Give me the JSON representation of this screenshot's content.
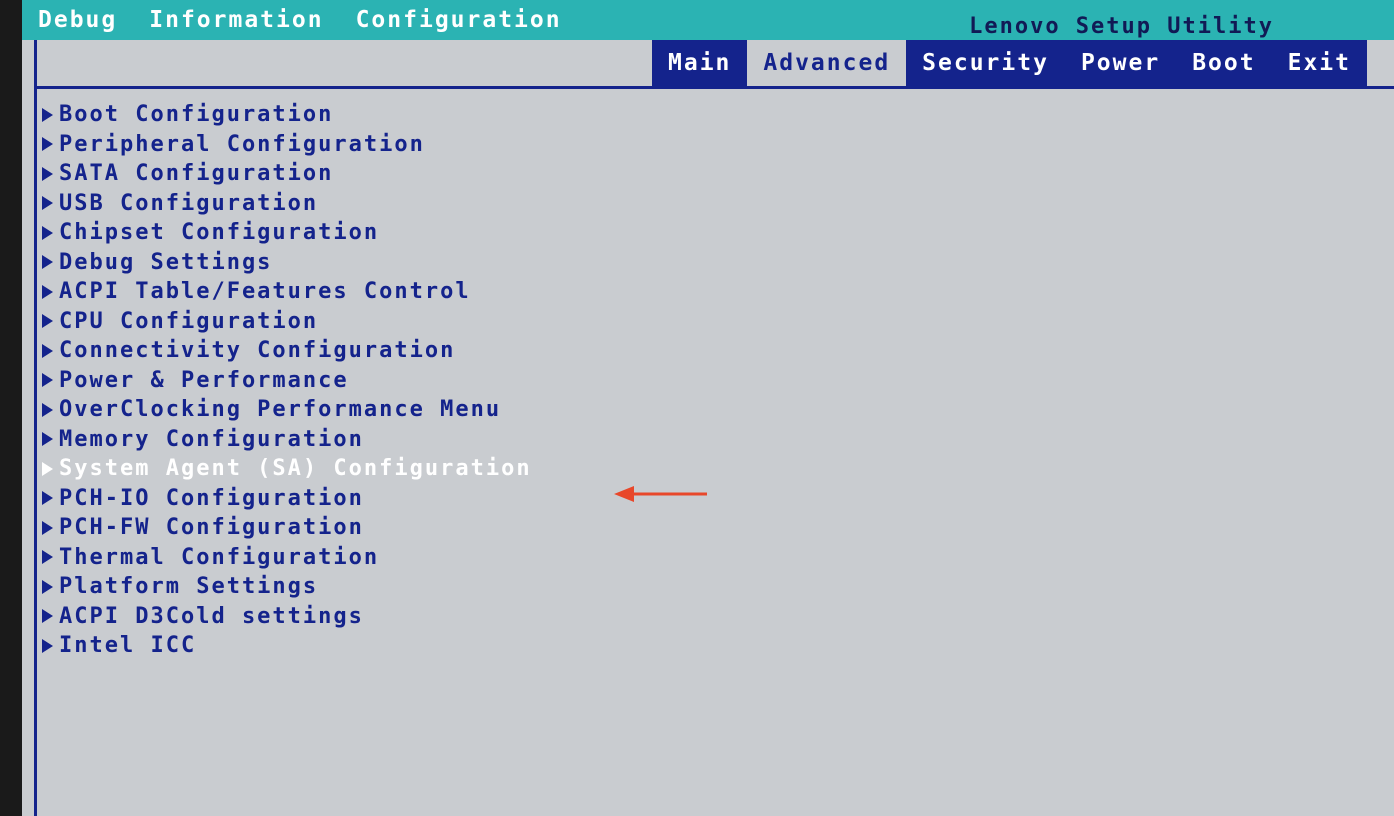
{
  "header": {
    "title": "Lenovo Setup Utility",
    "tabs_left": [
      "Debug",
      "Information",
      "Configuration"
    ],
    "tabs_right": [
      "Main",
      "Advanced",
      "Security",
      "Power",
      "Boot",
      "Exit"
    ],
    "active_tab": "Advanced"
  },
  "menu": {
    "items": [
      "Boot Configuration",
      "Peripheral Configuration",
      "SATA Configuration",
      "USB Configuration",
      "Chipset Configuration",
      "Debug Settings",
      "ACPI Table/Features Control",
      "CPU Configuration",
      "Connectivity Configuration",
      "Power & Performance",
      "OverClocking Performance Menu",
      "Memory Configuration",
      "System Agent (SA) Configuration",
      "PCH-IO Configuration",
      "PCH-FW Configuration",
      "Thermal Configuration",
      "Platform Settings",
      "ACPI D3Cold settings",
      "Intel ICC"
    ],
    "selected_index": 12,
    "item_icon": "triangle-right-icon"
  },
  "colors": {
    "tab_bar": "#2bb3b3",
    "panel": "#c9ccd0",
    "accent": "#14238c",
    "highlight": "#ffffff",
    "annotation_arrow": "#e8472a"
  }
}
